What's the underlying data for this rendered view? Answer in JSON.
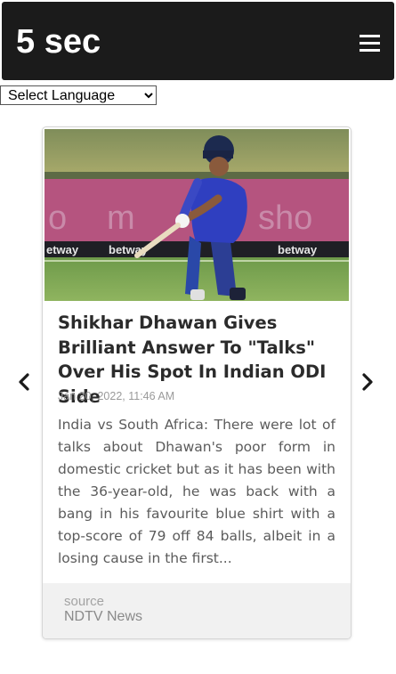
{
  "header": {
    "logo": "5 sec",
    "menu_icon": "hamburger-menu-icon"
  },
  "language_select": {
    "selected": "Select Language"
  },
  "navigation": {
    "prev_icon": "chevron-left-icon",
    "next_icon": "chevron-right-icon"
  },
  "article": {
    "title": "Shikhar Dhawan Gives Brilliant Answer To \"Talks\" Over His Spot In Indian ODI Side",
    "date": "Jan 20, 2022, 11:46 AM",
    "description": "India vs South Africa: There were lot of talks about Dhawan's poor form in domestic cricket but as it has been with the 36-year-old, he was back with a bang in his favourite blue shirt with a top-score of 79 off 84 balls, albeit in a losing cause in the first...",
    "image": "cricket-batsman-photo",
    "source_label": "source",
    "source_name": "NDTV News"
  },
  "colors": {
    "header_bg": "#1b1b1b",
    "title_text": "#2b2b2b",
    "body_text": "#5b5b5b",
    "footer_bg": "#f1f1f1"
  }
}
